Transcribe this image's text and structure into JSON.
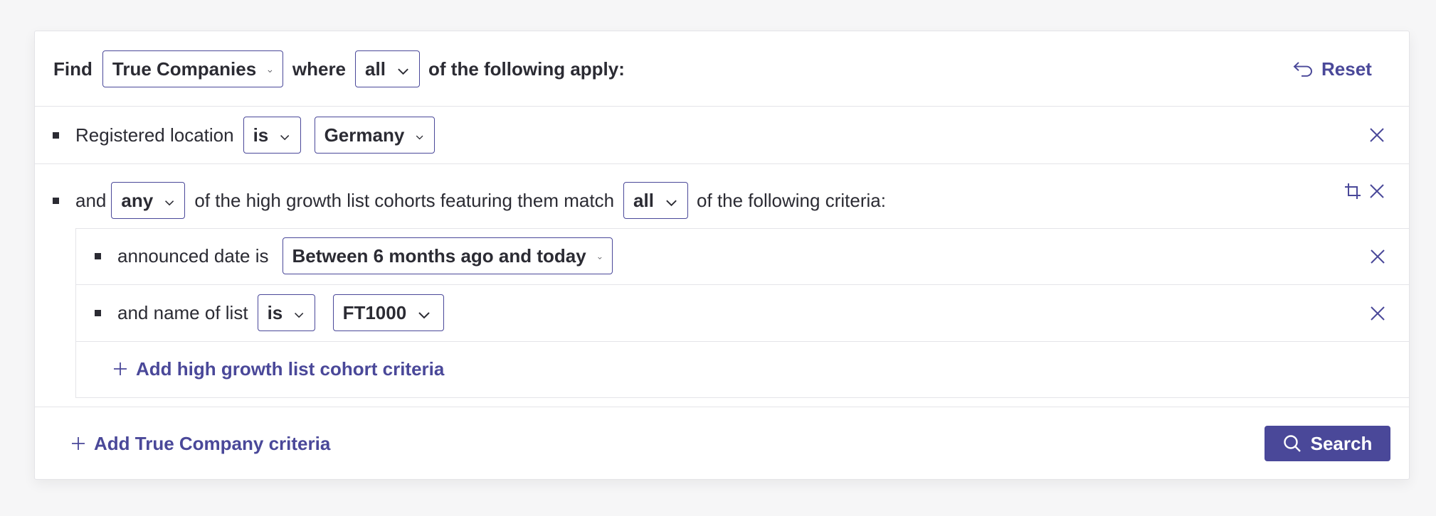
{
  "header": {
    "find_label": "Find",
    "entity_select": "True Companies",
    "where_label": "where",
    "quantifier_select": "all",
    "suffix_label": "of the following apply:",
    "reset_label": "Reset"
  },
  "criteria": {
    "location": {
      "label": "Registered location",
      "operator": "is",
      "value": "Germany"
    },
    "cohort_group": {
      "and_label": "and",
      "quantifier": "any",
      "middle_label": "of the high growth list cohorts featuring them match",
      "inner_quantifier": "all",
      "suffix_label": "of the following criteria:",
      "rows": [
        {
          "label": "announced date is",
          "value": "Between 6 months ago and today"
        },
        {
          "label": "and name of list",
          "operator": "is",
          "value": "FT1000"
        }
      ],
      "add_label": "Add high growth list cohort criteria"
    }
  },
  "footer": {
    "add_label": "Add True Company criteria",
    "search_label": "Search"
  },
  "colors": {
    "accent": "#4a4899",
    "text": "#2b2b33",
    "border": "#e4e4e8"
  }
}
